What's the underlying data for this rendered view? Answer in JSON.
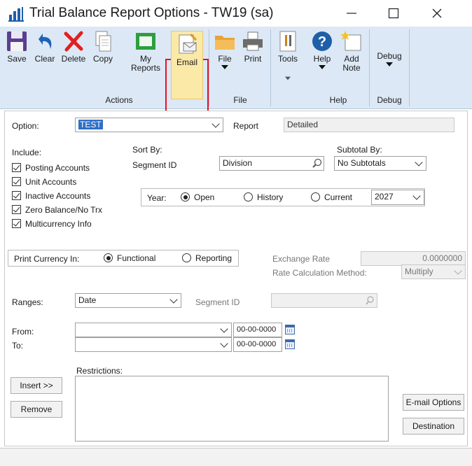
{
  "window": {
    "title": "Trial Balance Report Options  -  TW19 (sa)",
    "minimize_icon": "minimize-icon",
    "maximize_icon": "maximize-icon",
    "close_icon": "close-icon"
  },
  "ribbon": {
    "buttons": [
      {
        "label": "Save",
        "icon": "floppy-disk-icon"
      },
      {
        "label": "Clear",
        "icon": "undo-arrow-icon"
      },
      {
        "label": "Delete",
        "icon": "red-x-icon"
      },
      {
        "label": "Copy",
        "icon": "copy-pages-icon"
      },
      {
        "label": "My\nReports",
        "icon": "my-reports-icon"
      },
      {
        "label": "Email",
        "icon": "email-document-icon"
      },
      {
        "label": "File",
        "icon": "folder-icon"
      },
      {
        "label": "Print",
        "icon": "printer-icon"
      },
      {
        "label": "Tools",
        "icon": "tools-icon"
      },
      {
        "label": "Help",
        "icon": "help-icon"
      },
      {
        "label": "Add\nNote",
        "icon": "add-note-icon"
      },
      {
        "label": "Debug",
        "icon": "debug-icon"
      }
    ],
    "groups": {
      "actions": "Actions",
      "file": "File",
      "help": "Help",
      "debug": "Debug"
    },
    "highlight_color": "#e81123"
  },
  "form": {
    "option_label": "Option:",
    "option_value": "TEST",
    "report_label": "Report",
    "report_value": "Detailed",
    "include_label": "Include:",
    "include_items": [
      "Posting Accounts",
      "Unit Accounts",
      "Inactive Accounts",
      "Zero Balance/No Trx",
      "Multicurrency Info"
    ],
    "sort_by_label": "Sort By:",
    "segment_label": "Segment ID",
    "segment_value": "Division",
    "subtotal_label": "Subtotal By:",
    "subtotal_value": "No Subtotals",
    "year_label": "Year:",
    "year_options": [
      "Open",
      "History",
      "Current"
    ],
    "year_selected": "Open",
    "year_value": "2027",
    "print_currency_label": "Print Currency In:",
    "currency_options": [
      "Functional",
      "Reporting"
    ],
    "currency_selected": "Functional",
    "exchange_rate_label": "Exchange Rate",
    "exchange_rate_value": "0.0000000",
    "rate_calc_label": "Rate Calculation Method:",
    "rate_calc_value": "Multiply",
    "ranges_label": "Ranges:",
    "ranges_value": "Date",
    "range_segment_label": "Segment ID",
    "from_label": "From:",
    "to_label": "To:",
    "from_date": "00-00-0000",
    "to_date": "00-00-0000",
    "restrictions_label": "Restrictions:",
    "insert_button": "Insert >>",
    "remove_button": "Remove",
    "email_options_button": "E-mail Options",
    "destination_button": "Destination"
  }
}
